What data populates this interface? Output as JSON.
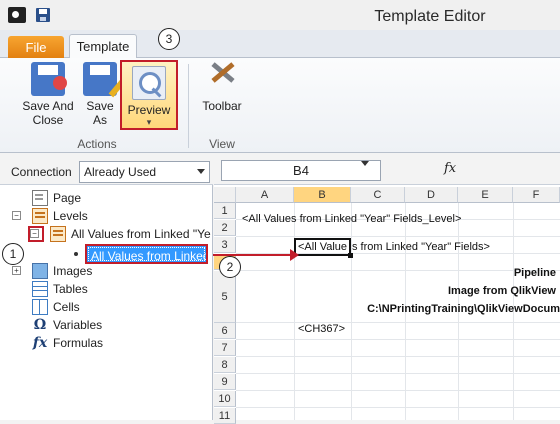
{
  "window": {
    "title": "Template Editor"
  },
  "tabs": {
    "file": "File",
    "template": "Template"
  },
  "ribbon": {
    "save_and_close_line1": "Save And",
    "save_and_close_line2": "Close",
    "save_as_line1": "Save",
    "save_as_line2": "As",
    "preview": "Preview",
    "toolbar": "Toolbar",
    "group_actions": "Actions",
    "group_view": "View"
  },
  "callouts": {
    "c1": "1",
    "c2": "2",
    "c3": "3"
  },
  "connection": {
    "label": "Connection",
    "value": "Already Used"
  },
  "tree": {
    "page": "Page",
    "levels": "Levels",
    "level_item": "All Values from Linked \"Ye",
    "level_child": "All Values from Linked",
    "images": "Images",
    "tables": "Tables",
    "cells": "Cells",
    "variables": "Variables",
    "formulas": "Formulas"
  },
  "formula_bar": {
    "cell_ref": "B4",
    "fx": "fx"
  },
  "sheet": {
    "columns": [
      "A",
      "B",
      "C",
      "D",
      "E",
      "F"
    ],
    "rows": [
      "1",
      "2",
      "3",
      "4",
      "5",
      "",
      "",
      "6",
      "7",
      "8",
      "9",
      "10",
      "11"
    ],
    "row2_text": "<All Values from Linked \"Year\" Fields_Level>",
    "b4_text": "<All Value",
    "b4_overflow": "s from Linked \"Year\" Fields>",
    "pipeline_1": "Pipeline",
    "pipeline_2": "Image from QlikView",
    "pipeline_3": "C:\\NPrintingTraining\\QlikViewDocum",
    "b6_text": "<CH367>"
  }
}
